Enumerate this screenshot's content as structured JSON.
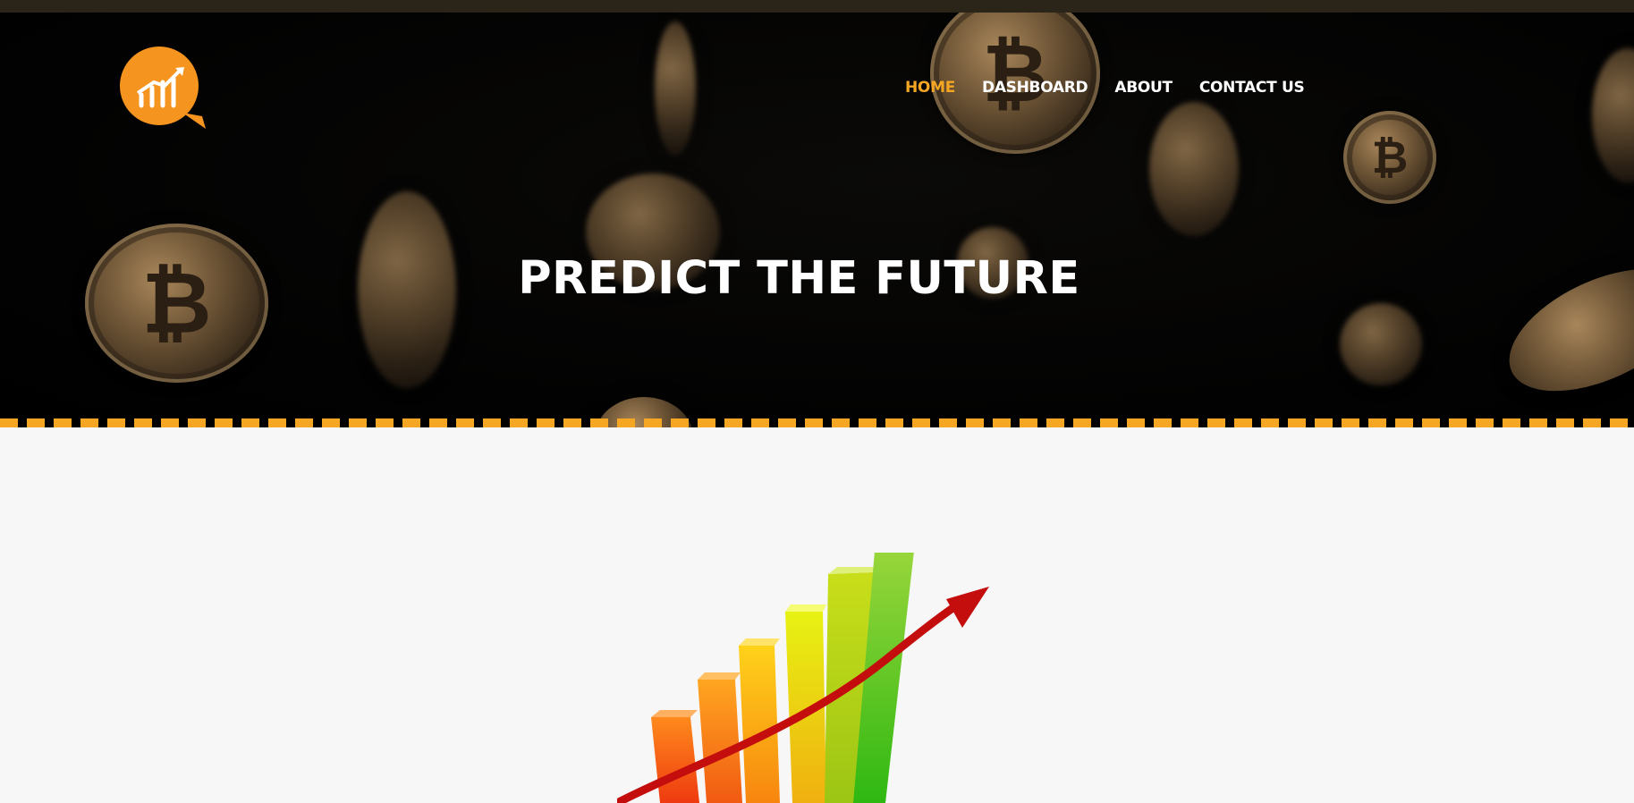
{
  "nav": {
    "items": [
      {
        "label": "HOME",
        "active": true
      },
      {
        "label": "DASHBOARD",
        "active": false
      },
      {
        "label": "ABOUT",
        "active": false
      },
      {
        "label": "CONTACT US",
        "active": false
      }
    ]
  },
  "hero": {
    "title": "PREDICT THE FUTURE"
  },
  "colors": {
    "accent": "#f5a623",
    "topbar": "#2b2418",
    "hero_bg": "#000000",
    "content_bg": "#f7f7f7"
  },
  "icons": {
    "logo": "chart-magnifier-logo",
    "coins": "bitcoin-coin",
    "illustration": "growth-bar-chart-arrow"
  }
}
